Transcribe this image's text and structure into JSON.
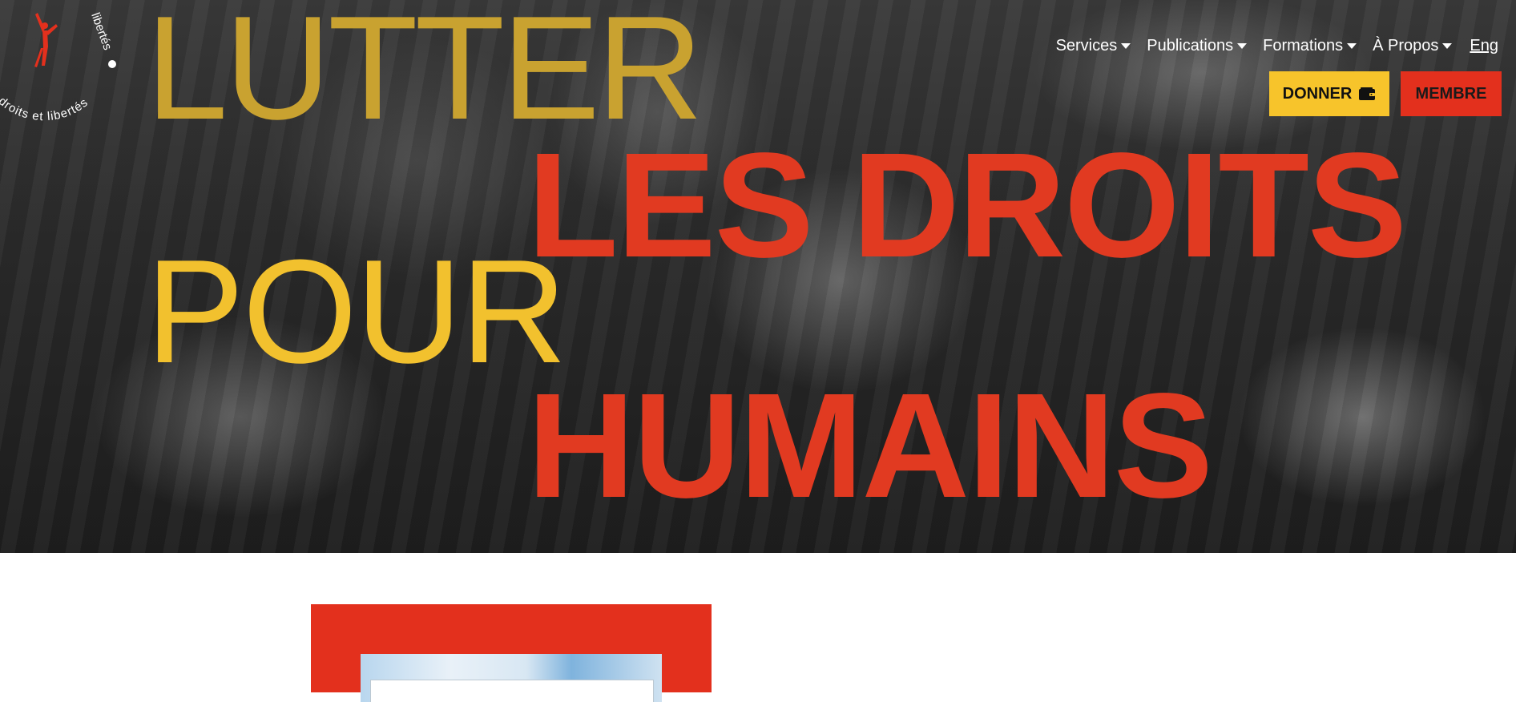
{
  "logo": {
    "arc_text": "droits et libertés",
    "arc_text_top": "libertés",
    "icon": "person-raised-fist-icon"
  },
  "hero": {
    "line1": "LUTTER",
    "line2": "LES DROITS",
    "line3": "POUR",
    "line4": "HUMAINS"
  },
  "nav": {
    "items": [
      {
        "label": "Services"
      },
      {
        "label": "Publications"
      },
      {
        "label": "Formations"
      },
      {
        "label": "À Propos"
      }
    ],
    "lang": "Eng"
  },
  "actions": {
    "donate_label": "DONNER",
    "donate_icon": "wallet-icon",
    "member_label": "MEMBRE"
  },
  "colors": {
    "gold": "#c9a230",
    "yellow": "#f2c12e",
    "red": "#e13a21",
    "donate_bg": "#f7c42b",
    "member_bg": "#e3301d"
  }
}
